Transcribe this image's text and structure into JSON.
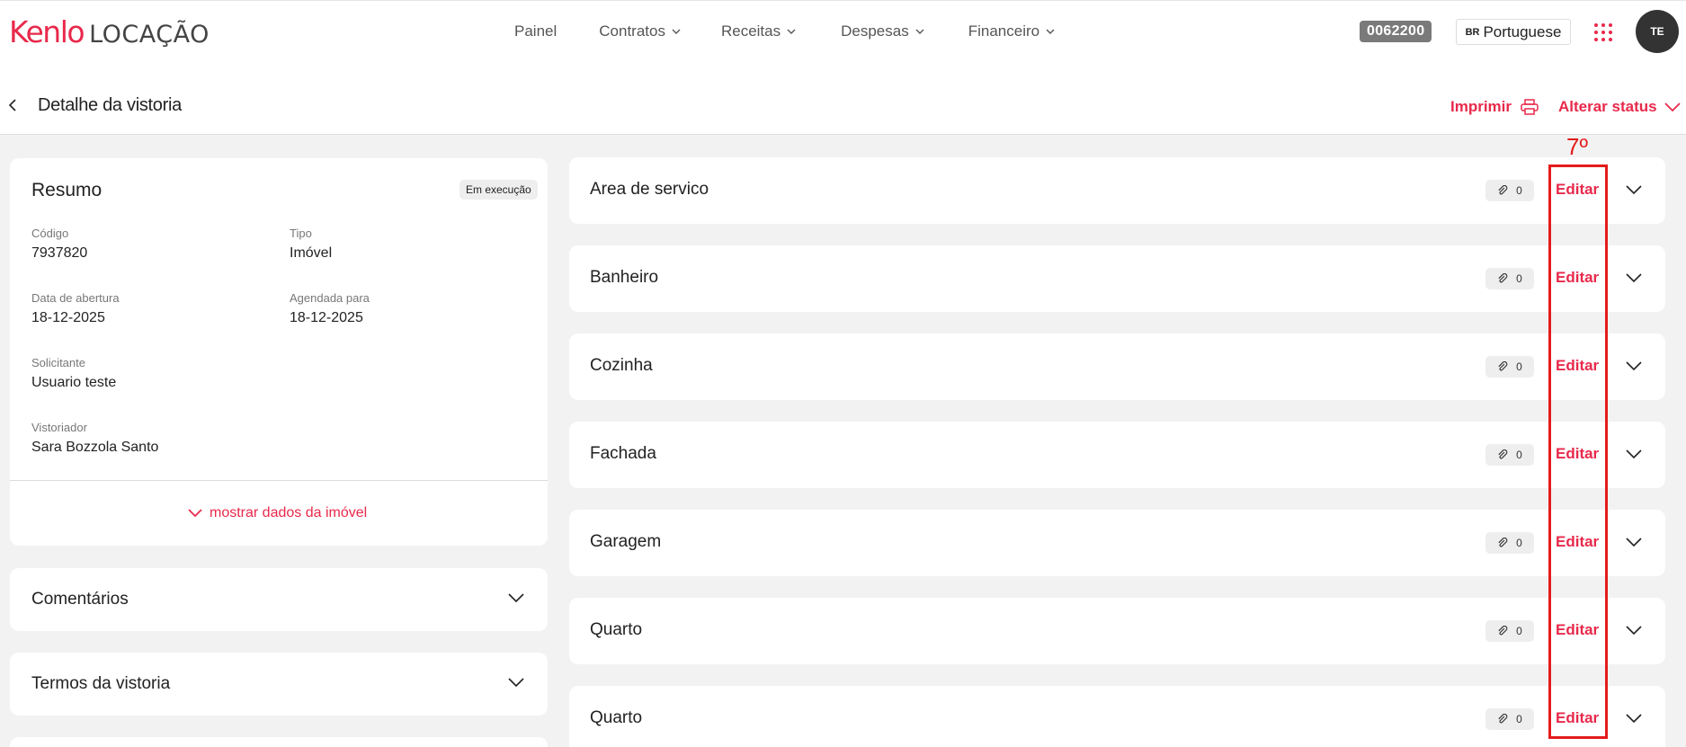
{
  "header": {
    "logo_brand": "Kenlo",
    "logo_product": "LOCAÇÃO",
    "nav": [
      "Painel",
      "Contratos",
      "Receitas",
      "Despesas",
      "Financeiro"
    ],
    "code": "0062200",
    "language_flag": "BR",
    "language": "Portuguese",
    "avatar_initials": "TE"
  },
  "subheader": {
    "title": "Detalhe da vistoria",
    "print_label": "Imprimir",
    "status_label": "Alterar status"
  },
  "resumo": {
    "title": "Resumo",
    "status_badge": "Em execução",
    "codigo_label": "Código",
    "codigo_value": "7937820",
    "tipo_label": "Tipo",
    "tipo_value": "Imóvel",
    "abertura_label": "Data de abertura",
    "abertura_value": "18-12-2025",
    "agendada_label": "Agendada para",
    "agendada_value": "18-12-2025",
    "solicitante_label": "Solicitante",
    "solicitante_value": "Usuario teste",
    "vistoriador_label": "Vistoriador",
    "vistoriador_value": "Sara Bozzola Santo",
    "show_more": "mostrar dados da imóvel"
  },
  "left_accordions": [
    "Comentários",
    "Termos da vistoria"
  ],
  "rooms": [
    {
      "name": "Area de servico",
      "attachments": "0",
      "edit": "Editar"
    },
    {
      "name": "Banheiro",
      "attachments": "0",
      "edit": "Editar"
    },
    {
      "name": "Cozinha",
      "attachments": "0",
      "edit": "Editar"
    },
    {
      "name": "Fachada",
      "attachments": "0",
      "edit": "Editar"
    },
    {
      "name": "Garagem",
      "attachments": "0",
      "edit": "Editar"
    },
    {
      "name": "Quarto",
      "attachments": "0",
      "edit": "Editar"
    },
    {
      "name": "Quarto",
      "attachments": "0",
      "edit": "Editar"
    }
  ],
  "annotation": {
    "label": "7º",
    "color": "#e41b1b"
  },
  "colors": {
    "accent": "#e8294b",
    "background": "#f2f2f2"
  }
}
